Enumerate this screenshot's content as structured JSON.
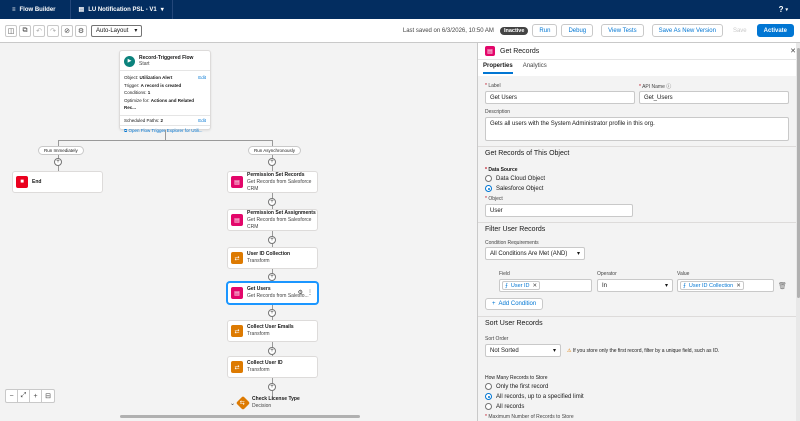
{
  "header": {
    "app_label": "Flow Builder",
    "tab_label": "LU Notification PSL - V1",
    "help_label": "?"
  },
  "toolbar": {
    "layout_select": "Auto-Layout",
    "saved_text": "Last saved on 6/3/2026, 10:50 AM",
    "status_badge": "Inactive",
    "run_label": "Run",
    "debug_label": "Debug",
    "view_tests_label": "View Tests",
    "save_as_label": "Save As New Version",
    "save_label": "Save",
    "activate_label": "Activate"
  },
  "start": {
    "title": "Record-Triggered Flow",
    "subtitle": "Start",
    "object_label": "Object:",
    "object_value": "Utilization Alert",
    "trigger_label": "Trigger:",
    "trigger_value": "A record is created",
    "conditions_label": "Conditions:",
    "conditions_value": "1",
    "optimize_label": "Optimize for:",
    "optimize_value": "Actions and Related Rec...",
    "scheduled_label": "Scheduled Paths:",
    "scheduled_value": "2",
    "edit_label": "Edit",
    "explorer_link": "Open Flow Trigger Explorer for Utili..."
  },
  "branches": {
    "left": "Run Immediately",
    "right": "Run Asynchronously"
  },
  "end_node": {
    "label": "End"
  },
  "nodes": [
    {
      "title": "Permission Set Records",
      "sub": "Get Records from Salesforce CRM",
      "icon": "get-records-icon"
    },
    {
      "title": "Permission Set Assignments",
      "sub": "Get Records from Salesforce CRM",
      "icon": "get-records-icon"
    },
    {
      "title": "User ID Collection",
      "sub": "Transform",
      "icon": "transform-icon"
    },
    {
      "title": "Get Users",
      "sub": "Get Records from Salesfo...",
      "icon": "get-records-icon"
    },
    {
      "title": "Collect User Emails",
      "sub": "Transform",
      "icon": "transform-icon"
    },
    {
      "title": "Collect User ID",
      "sub": "Transform",
      "icon": "transform-icon"
    },
    {
      "title": "Check License Type",
      "sub": "Decision",
      "icon": "decision-icon"
    }
  ],
  "panel": {
    "title": "Get Records",
    "tab_properties": "Properties",
    "tab_analytics": "Analytics",
    "label_label": "Label",
    "label_value": "Get Users",
    "api_label": "API Name",
    "api_value": "Get_Users",
    "desc_label": "Description",
    "desc_value": "Gets all users with the System Administrator profile in this org.",
    "section_get": "Get Records of This Object",
    "data_source_label": "Data Source",
    "ds_option1": "Data Cloud Object",
    "ds_option2": "Salesforce Object",
    "object_label": "Object",
    "object_value": "User",
    "section_filter": "Filter User Records",
    "cond_req_label": "Condition Requirements",
    "cond_req_value": "All Conditions Are Met (AND)",
    "field_label": "Field",
    "operator_label": "Operator",
    "value_label": "Value",
    "field_value": "User ID",
    "operator_value": "In",
    "value_value": "User ID Collection",
    "add_condition": "Add Condition",
    "section_sort": "Sort User Records",
    "sort_order_label": "Sort Order",
    "sort_order_value": "Not Sorted",
    "sort_hint": "If you store only the first record, filter by a unique field, such as ID.",
    "how_many_label": "How Many Records to Store",
    "hm_option1": "Only the first record",
    "hm_option2": "All records, up to a specified limit",
    "hm_option3": "All records",
    "max_label": "Maximum Number of Records to Store"
  },
  "colors": {
    "nav": "#032d60",
    "brand": "#0176d3",
    "get_records": "#e3066a",
    "transform": "#dd7a01",
    "end": "#ea001e"
  }
}
